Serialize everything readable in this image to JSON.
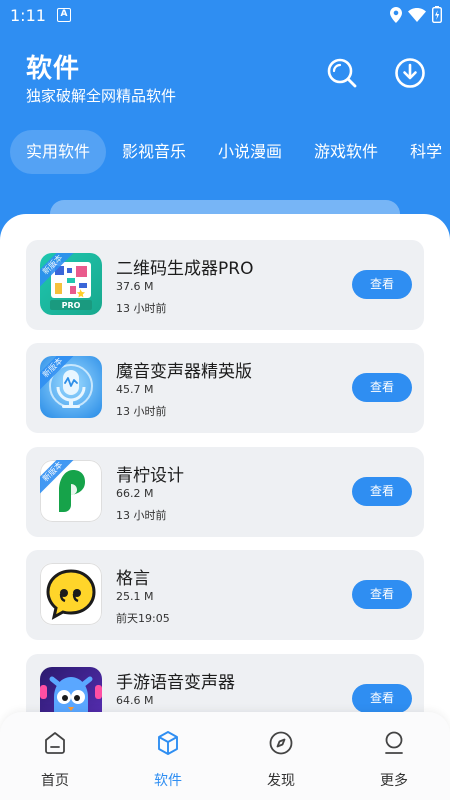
{
  "status_bar": {
    "time": "1:11",
    "notif_icon_letter": "A"
  },
  "header": {
    "title": "软件",
    "subtitle": "独家破解全网精品软件",
    "bg_color": "#2f8ef2"
  },
  "tabs": [
    {
      "label": "实用软件",
      "active": true
    },
    {
      "label": "影视音乐",
      "active": false
    },
    {
      "label": "小说漫画",
      "active": false
    },
    {
      "label": "游戏软件",
      "active": false
    },
    {
      "label": "科学",
      "active": false
    }
  ],
  "apps": [
    {
      "name": "二维码生成器PRO",
      "size": "37.6 M",
      "time": "13 小时前",
      "button": "查看",
      "icon": "qr-code-pro-icon",
      "badge": "新版本"
    },
    {
      "name": "魔音变声器精英版",
      "size": "45.7 M",
      "time": "13 小时前",
      "button": "查看",
      "icon": "microphone-icon",
      "badge": "新版本"
    },
    {
      "name": "青柠设计",
      "size": "66.2 M",
      "time": "13 小时前",
      "button": "查看",
      "icon": "green-leaf-icon",
      "badge": "新版本"
    },
    {
      "name": "格言",
      "size": "25.1 M",
      "time": "前天19:05",
      "button": "查看",
      "icon": "quote-bubble-icon"
    },
    {
      "name": "手游语音变声器",
      "size": "64.6 M",
      "time": "",
      "button": "查看",
      "icon": "owl-mascot-icon"
    }
  ],
  "bottom_nav": [
    {
      "label": "首页",
      "icon": "home-icon",
      "active": false
    },
    {
      "label": "软件",
      "icon": "cube-icon",
      "active": true
    },
    {
      "label": "发现",
      "icon": "compass-icon",
      "active": false
    },
    {
      "label": "更多",
      "icon": "user-icon",
      "active": false
    }
  ]
}
